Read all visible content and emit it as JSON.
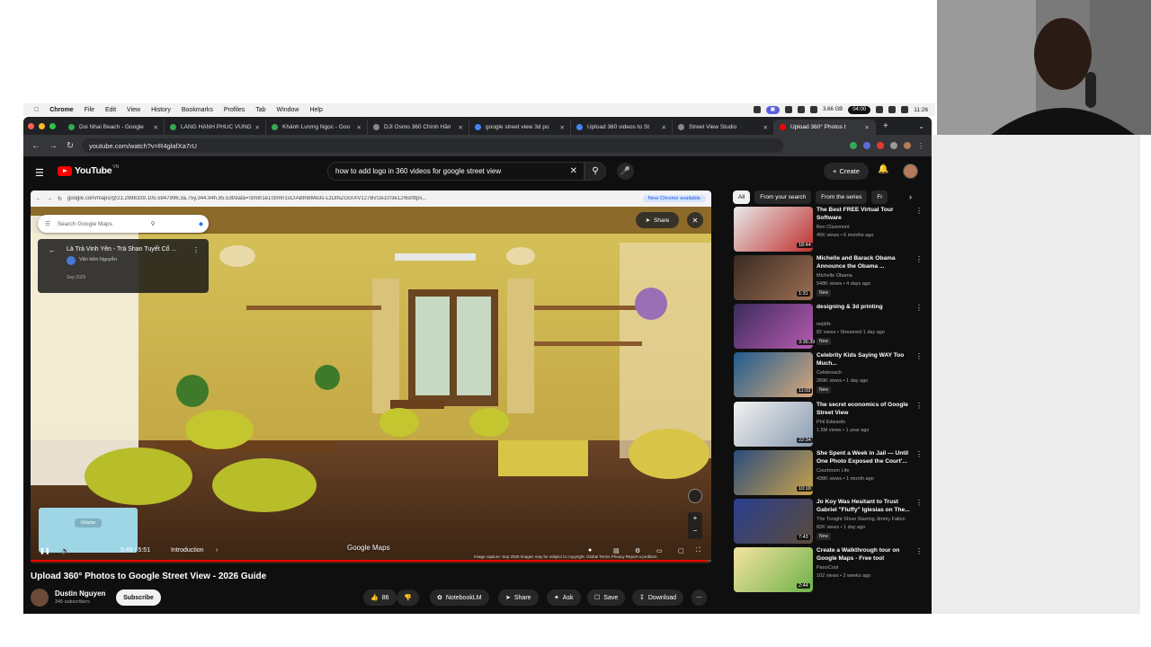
{
  "menubar": {
    "app": "Chrome",
    "items": [
      "File",
      "Edit",
      "View",
      "History",
      "Bookmarks",
      "Profiles",
      "Tab",
      "Window",
      "Help"
    ],
    "timer": "04:00",
    "memory": "3.66 GB",
    "clock": "11:26"
  },
  "tabs": [
    {
      "label": "Doi Nhai Beach - Google",
      "color": "#34a853"
    },
    {
      "label": "LÀNG HẠNH PHÚC VŨNG",
      "color": "#34a853"
    },
    {
      "label": "Khánh Lương Ngọc - Goo",
      "color": "#34a853"
    },
    {
      "label": "DJI Osmo 360 Chính Hãn",
      "color": "#888888"
    },
    {
      "label": "google street view 3d po",
      "color": "#4285f4"
    },
    {
      "label": "Upload 360 videos to St",
      "color": "#4285f4"
    },
    {
      "label": "Street View Studio",
      "color": "#888888"
    },
    {
      "label": "Upload 360° Photos t",
      "color": "#ff0000"
    }
  ],
  "address": {
    "url": "youtube.com/watch?v=R4glafXa7rU"
  },
  "youtube": {
    "logo": "YouTube",
    "region": "VN",
    "search_query": "how to add logo in 360 videos for google street view",
    "create_label": "Create"
  },
  "player": {
    "inner_url": "google.com/maps/@21.2998339,105.5947996,3a,75y,344.94h,85.53t/data=!3m8!1e1!3m6!1sCIABIhBMe3s-LzDiNZGcnXV127Bv!2e10!3e12!6shttps...",
    "new_chrome": "New Chrome available",
    "gm_search_placeholder": "Search Google Maps",
    "place_title": "Là Trà Vinh Yên - Trà Shan Tuyết Cổ ...",
    "place_author": "Văn kiên Nguyễn",
    "place_date": "Sep 2025",
    "share_label": "Share",
    "gm_logo": "Google Maps",
    "capture_text": "Image capture: Sep 2025    Images may be subject to copyright.    Global    Terms    Privacy    Report a problem",
    "volume_tip": "Volume",
    "time": "5:49 / 5:51",
    "chapter": "Introduction",
    "progress_fraction": 0.994
  },
  "video": {
    "title": "Upload 360° Photos to Google Street View - 2026 Guide",
    "channel": "Dustin Nguyen",
    "subscribers": "345 subscribers",
    "subscribe_label": "Subscribe",
    "likes": "86",
    "notebook": "NotebookLM",
    "share": "Share",
    "ask": "Ask",
    "save": "Save",
    "download": "Download"
  },
  "chips": [
    "All",
    "From your search",
    "From the series",
    "Fr"
  ],
  "recommendations": [
    {
      "title": "The Best FREE Virtual Tour Software",
      "channel": "Ben Claremont",
      "meta": "45K views • 6 months ago",
      "duration": "18:44",
      "new": "",
      "colors": [
        "#e8e8e8",
        "#c03030"
      ]
    },
    {
      "title": "Michelle and Barack Obama Announce the Obama ...",
      "channel": "Michelle Obama",
      "meta": "548K views • 4 days ago",
      "duration": "1:31",
      "new": "New",
      "colors": [
        "#3a2a22",
        "#9b6e52"
      ]
    },
    {
      "title": "designing & 3d printing",
      "channel": "nejibfx",
      "meta": "82 views • Streamed 1 day ago",
      "duration": "3:36:39",
      "new": "New",
      "colors": [
        "#3b2c5c",
        "#b85ab0"
      ]
    },
    {
      "title": "Celebrity Kids Saying WAY Too Much...",
      "channel": "Celebreach",
      "meta": "289K views • 1 day ago",
      "duration": "11:03",
      "new": "New",
      "colors": [
        "#1f5b8f",
        "#d9a77a"
      ]
    },
    {
      "title": "The secret economics of Google Street View",
      "channel": "Phil Edwards",
      "meta": "1.5M views • 1 year ago",
      "duration": "22:34",
      "new": "",
      "colors": [
        "#f2f2f2",
        "#8a9cb0"
      ]
    },
    {
      "title": "She Spent a Week in Jail — Until One Photo Exposed the Court'...",
      "channel": "Courtroom Life",
      "meta": "438K views • 1 month ago",
      "duration": "10:18",
      "new": "",
      "colors": [
        "#2b4c7e",
        "#c9a24a"
      ]
    },
    {
      "title": "Jo Koy Was Hesitant to Trust Gabriel \"Fluffy\" Iglesias on The...",
      "channel": "The Tonight Show Starring Jimmy Fallon",
      "meta": "82K views • 1 day ago",
      "duration": "7:43",
      "new": "New",
      "colors": [
        "#2a3f8f",
        "#5a4a3a"
      ]
    },
    {
      "title": "Create a Walkthrough tour on Google Maps - Free tool",
      "channel": "PanoCool",
      "meta": "102 views • 2 weeks ago",
      "duration": "2:44",
      "new": "",
      "colors": [
        "#f4e3a0",
        "#6fb24a"
      ]
    }
  ]
}
